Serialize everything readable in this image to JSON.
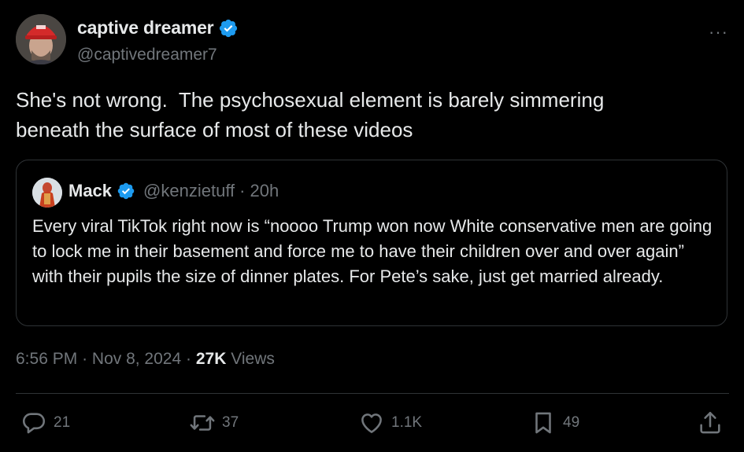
{
  "author": {
    "name": "captive dreamer",
    "handle": "@captivedreamer7",
    "verified": true,
    "avatar_icon": "profile-photo-red-cap"
  },
  "tweet": {
    "text": "She's not wrong.  The psychosexual element is barely simmering\nbeneath the surface of most of these videos"
  },
  "quoted": {
    "name": "Mack",
    "handle": "@kenzietuff",
    "separator": "·",
    "time": "20h",
    "verified": true,
    "text": "Every viral TikTok right now is “noooo Trump won now White conservative men are going to lock me in their basement and force me to have their children over and over again” with their pupils the size of dinner plates. For Pete’s sake, just get married already."
  },
  "meta": {
    "time": "6:56 PM",
    "separator": "·",
    "date": "Nov 8, 2024",
    "views_count": "27K",
    "views_label": "Views"
  },
  "actions": {
    "replies": "21",
    "reposts": "37",
    "likes": "1.1K",
    "bookmarks": "49"
  },
  "colors": {
    "background": "#000000",
    "text": "#e7e9ea",
    "muted": "#71767b",
    "border": "#2f3336",
    "verified": "#1d9bf0"
  }
}
